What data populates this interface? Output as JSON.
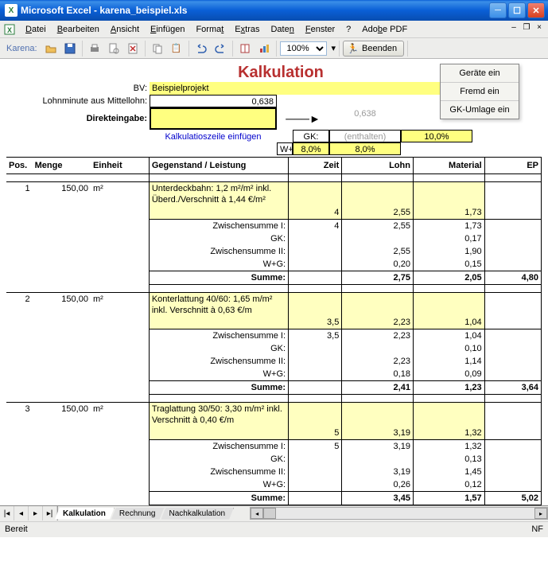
{
  "titlebar": {
    "app": "Microsoft Excel",
    "doc": "karena_beispiel.xls"
  },
  "menu": {
    "datei": "Datei",
    "bearbeiten": "Bearbeiten",
    "ansicht": "Ansicht",
    "einfuegen": "Einfügen",
    "format": "Format",
    "extras": "Extras",
    "daten": "Daten",
    "fenster": "Fenster",
    "hilfe": "?",
    "adobe": "Adobe PDF"
  },
  "toolbar": {
    "label": "Karena:",
    "zoom": "100%",
    "beenden": "Beenden"
  },
  "panel": {
    "geraete": "Geräte ein",
    "fremd": "Fremd ein",
    "gk": "GK-Umlage ein"
  },
  "head": {
    "title": "Kalkulation",
    "bv_label": "BV:",
    "bv_value": "Beispielprojekt",
    "lohn_label": "Lohnminute aus Mittellohn:",
    "lohn_value": "0,638",
    "direkt_label": "Direkteingabe:",
    "direkt_value": "",
    "ghost_value": "0,638",
    "gk_label": "GK:",
    "gk_enthalten": "(enthalten)",
    "gk_pct": "10,0%",
    "wg_label": "W+G:",
    "wg_lohn": "8,0%",
    "wg_mat": "8,0%",
    "kalk_link": "Kalkulatioszeile einfügen"
  },
  "cols": {
    "pos": "Pos.",
    "menge": "Menge",
    "einheit": "Einheit",
    "gegen": "Gegenstand / Leistung",
    "zeit": "Zeit",
    "lohn": "Lohn",
    "material": "Material",
    "ep": "EP"
  },
  "labels": {
    "zs1": "Zwischensumme I:",
    "gk": "GK:",
    "zs2": "Zwischensumme II:",
    "wg": "W+G:",
    "summe": "Summe:"
  },
  "rows": [
    {
      "pos": "1",
      "menge": "150,00",
      "einheit": "m²",
      "desc": "Unterdeckbahn: 1,2 m²/m² inkl. Überd./Verschnitt à 1,44 €/m²",
      "zeit": "4",
      "lohn": "2,55",
      "mat": "1,73",
      "zs1": {
        "zeit": "4",
        "lohn": "2,55",
        "mat": "1,73"
      },
      "gk": {
        "mat": "0,17"
      },
      "zs2": {
        "lohn": "2,55",
        "mat": "1,90"
      },
      "wg": {
        "lohn": "0,20",
        "mat": "0,15"
      },
      "sum": {
        "lohn": "2,75",
        "mat": "2,05",
        "ep": "4,80"
      }
    },
    {
      "pos": "2",
      "menge": "150,00",
      "einheit": "m²",
      "desc": "Konterlattung 40/60: 1,65 m/m² inkl. Verschnitt à 0,63 €/m",
      "zeit": "3,5",
      "lohn": "2,23",
      "mat": "1,04",
      "zs1": {
        "zeit": "3,5",
        "lohn": "2,23",
        "mat": "1,04"
      },
      "gk": {
        "mat": "0,10"
      },
      "zs2": {
        "lohn": "2,23",
        "mat": "1,14"
      },
      "wg": {
        "lohn": "0,18",
        "mat": "0,09"
      },
      "sum": {
        "lohn": "2,41",
        "mat": "1,23",
        "ep": "3,64"
      }
    },
    {
      "pos": "3",
      "menge": "150,00",
      "einheit": "m²",
      "desc": "Traglattung 30/50: 3,30 m/m² inkl. Verschnitt à 0,40 €/m",
      "zeit": "5",
      "lohn": "3,19",
      "mat": "1,32",
      "zs1": {
        "zeit": "5",
        "lohn": "3,19",
        "mat": "1,32"
      },
      "gk": {
        "mat": "0,13"
      },
      "zs2": {
        "lohn": "3,19",
        "mat": "1,45"
      },
      "wg": {
        "lohn": "0,26",
        "mat": "0,12"
      },
      "sum": {
        "lohn": "3,45",
        "mat": "1,57",
        "ep": "5,02"
      }
    }
  ],
  "tabs": {
    "t1": "Kalkulation",
    "t2": "Rechnung",
    "t3": "Nachkalkulation"
  },
  "status": {
    "ready": "Bereit",
    "nf": "NF"
  }
}
